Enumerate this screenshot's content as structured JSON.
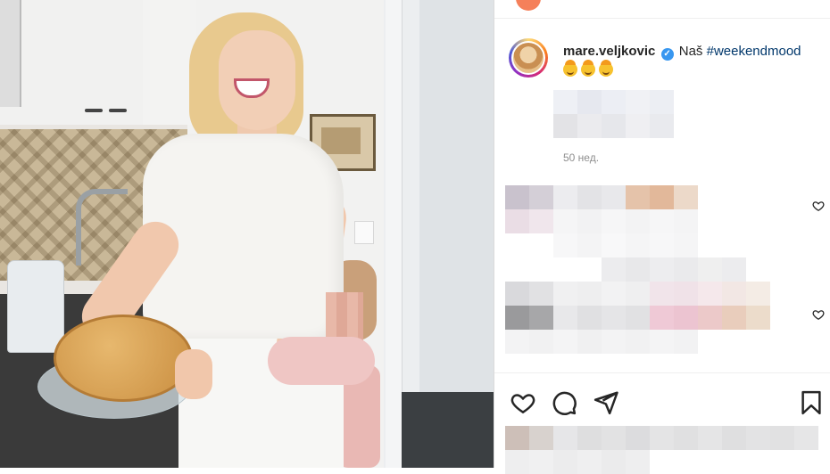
{
  "post": {
    "username": "mare.veljkovic",
    "verified_badge": "✓",
    "caption_text": "Naš",
    "hashtag": "#weekendmood",
    "emojis": [
      "cowboy-face-emoji",
      "cowboy-face-emoji",
      "cowboy-face-emoji"
    ],
    "timestamp": "50 нед."
  },
  "colors": {
    "accent_blue": "#3897f0",
    "hashtag_blue": "#00376b",
    "muted_text": "#8e8e8e",
    "primary_text": "#262626"
  },
  "icons": {
    "like": "heart-icon",
    "comment": "comment-icon",
    "share": "send-icon",
    "save": "bookmark-icon",
    "comment_like": "heart-icon"
  }
}
